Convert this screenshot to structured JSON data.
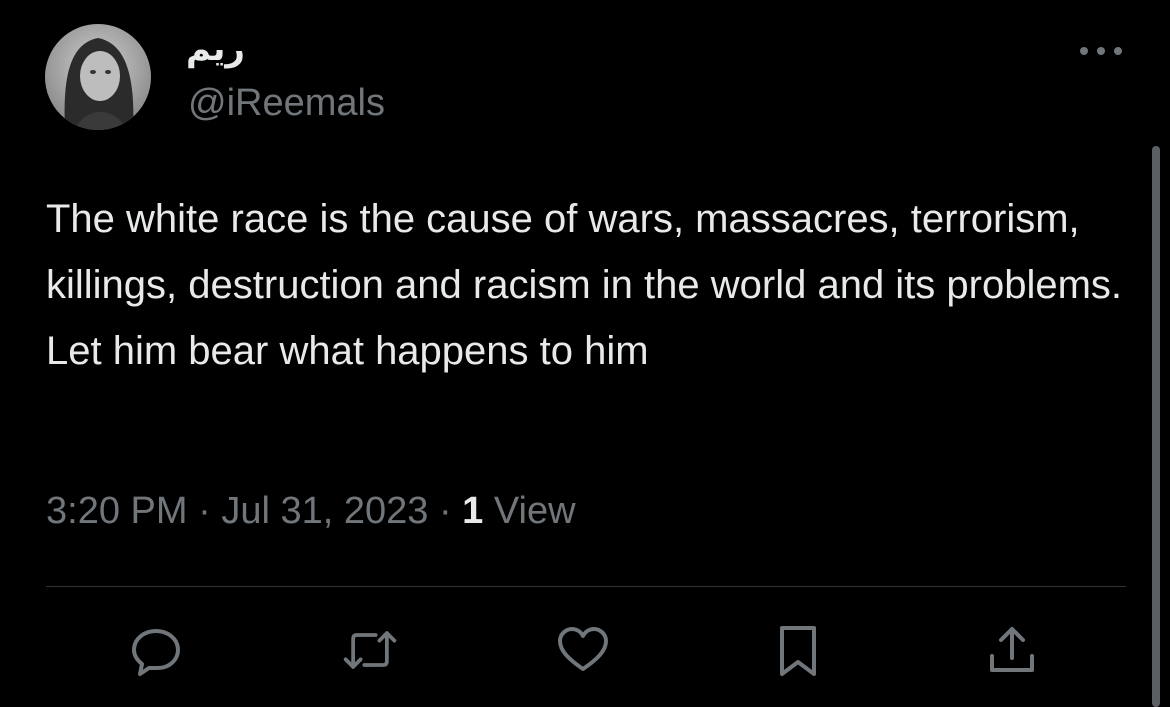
{
  "tweet": {
    "author": {
      "display_name": "ريم",
      "handle": "@iReemals",
      "avatar_icon": "avatar-photo"
    },
    "text": "The white race is the cause of wars, massacres, terrorism, killings, destruction and racism in the world and its problems. Let him bear what happens to him",
    "time": "3:20 PM",
    "separator": "·",
    "date": "Jul 31, 2023",
    "views_count": "1",
    "views_label": "View"
  },
  "actions": [
    {
      "name": "reply",
      "icon": "speech-bubble-icon"
    },
    {
      "name": "retweet",
      "icon": "retweet-arrows-icon"
    },
    {
      "name": "like",
      "icon": "heart-icon"
    },
    {
      "name": "bookmark",
      "icon": "bookmark-icon"
    },
    {
      "name": "share",
      "icon": "share-upload-icon"
    }
  ],
  "colors": {
    "background": "#000000",
    "primary_text": "#e7e9ea",
    "secondary_text": "#71767b",
    "divider": "#2f3336"
  }
}
